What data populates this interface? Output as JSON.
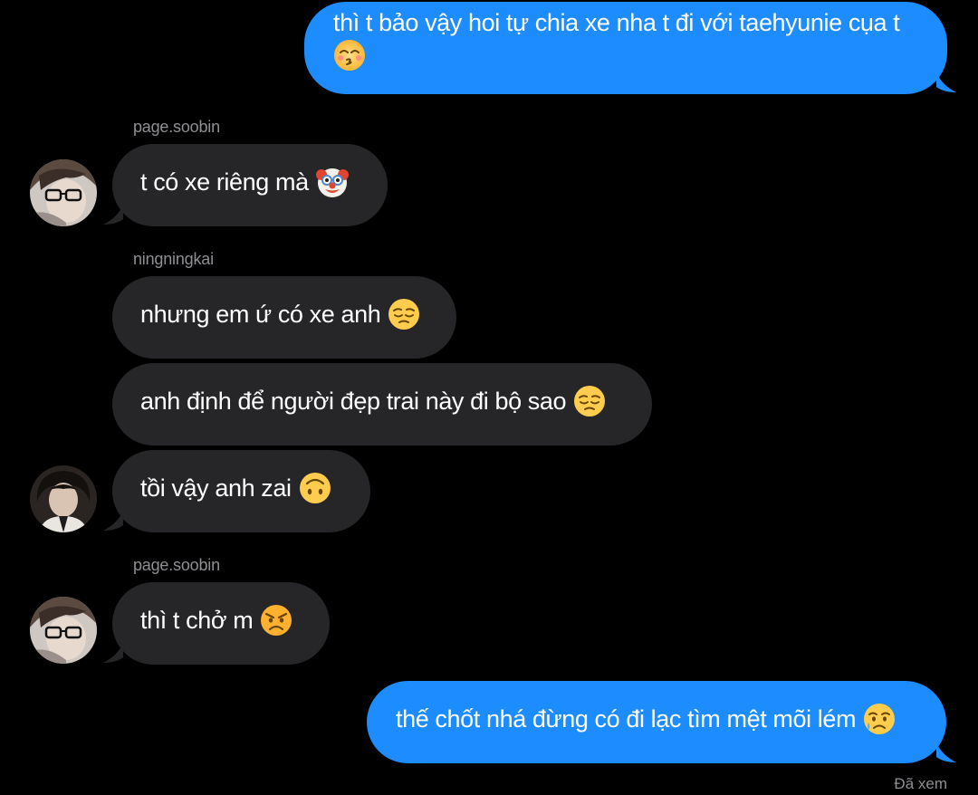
{
  "messages": [
    {
      "id": "m1",
      "direction": "outgoing",
      "text": "thì t bảo vậy hoi tự chia xe nha t đi với taehyunie cụa t",
      "emoji": "kissing-closed-eyes-emoji"
    },
    {
      "id": "m2",
      "direction": "incoming",
      "sender": "page.soobin",
      "text": "t có xe riêng mà",
      "emoji": "clown-face-emoji"
    },
    {
      "id": "m3",
      "direction": "incoming",
      "sender": "ningningkai",
      "text": "nhưng em ứ có xe anh",
      "emoji": "pensive-face-emoji"
    },
    {
      "id": "m4",
      "direction": "incoming",
      "text": "anh định để người đẹp trai này đi bộ sao",
      "emoji": "pensive-face-emoji"
    },
    {
      "id": "m5",
      "direction": "incoming",
      "text": "tồi vậy anh zai",
      "emoji": "upside-down-face-emoji"
    },
    {
      "id": "m6",
      "direction": "incoming",
      "sender": "page.soobin",
      "text": "thì t chở m",
      "emoji": "angry-face-emoji"
    },
    {
      "id": "m7",
      "direction": "outgoing",
      "text": "thế chốt nhá đừng có đi lạc tìm mệt mõi lém",
      "emoji": "crying-face-emoji"
    }
  ],
  "status": {
    "seen_label": "Đã xem"
  },
  "colors": {
    "background": "#000000",
    "outgoing_bubble": "#1c8cff",
    "incoming_bubble": "#262629",
    "sender_label": "#8e8e93",
    "text": "#ffffff"
  }
}
